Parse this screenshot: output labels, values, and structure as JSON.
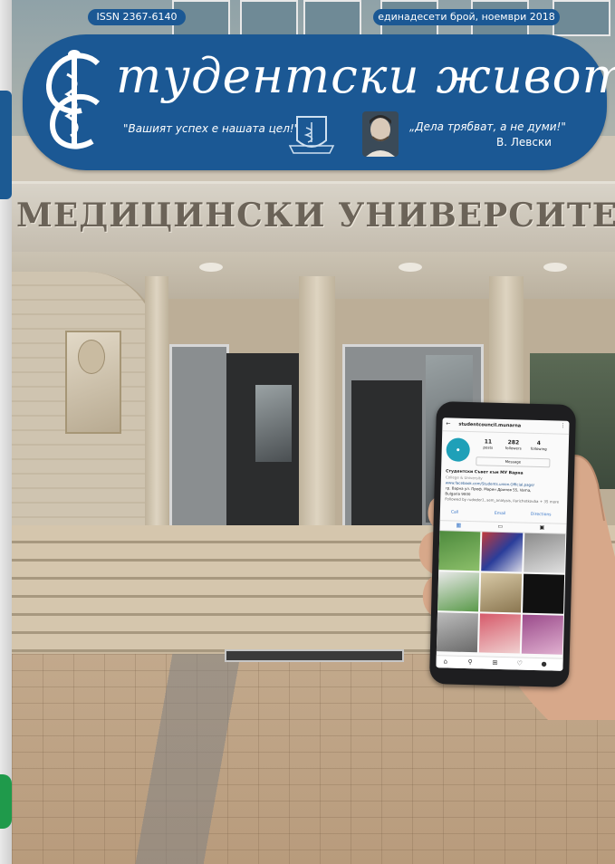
{
  "header": {
    "issn": "ISSN 2367-6140",
    "issue": "единадесети брой, ноември 2018",
    "title": "тудентски живот",
    "motto": "\"Вашият успех е нашата цел!\"",
    "quote": "„Дела трябват, а не думи!\"",
    "quote_author": "В. Левски"
  },
  "building": {
    "sign": "МЕДИЦИНСКИ УНИВЕРСИТЕТ"
  },
  "phone": {
    "username": "studentcouncil.munarna",
    "stats": [
      {
        "value": "11",
        "label": "posts"
      },
      {
        "value": "282",
        "label": "followers"
      },
      {
        "value": "4",
        "label": "following"
      }
    ],
    "message_label": "Message",
    "bio_name": "Студентски Съвет към МУ Варна",
    "bio_category": "College & University",
    "bio_lines": [
      "www.facebook.com/Students.union.Official.page/",
      "гр. Варна ул. Проф. Марин Дринов 55, Varna,",
      "Bulgaria 9000"
    ],
    "followed_by": "Followed by rudodor1, sem_analysis, ilarichetkovba + 35 more",
    "actions": [
      "Call",
      "Email",
      "Directions"
    ]
  }
}
